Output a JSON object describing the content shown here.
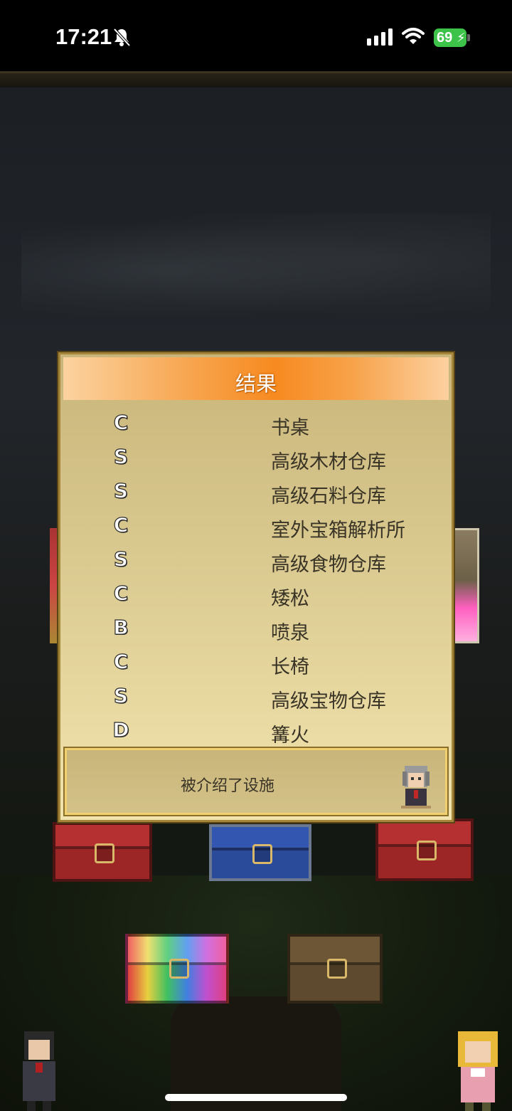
{
  "status_bar": {
    "time": "17:21",
    "battery": "69",
    "icons": [
      "bell-slash-icon",
      "cellular-signal-icon",
      "wifi-icon",
      "battery-charging-icon"
    ]
  },
  "dialog": {
    "title": "结果",
    "results": [
      {
        "grade": "C",
        "facility": "书桌"
      },
      {
        "grade": "S",
        "facility": "高级木材仓库"
      },
      {
        "grade": "S",
        "facility": "高级石料仓库"
      },
      {
        "grade": "C",
        "facility": "室外宝箱解析所"
      },
      {
        "grade": "S",
        "facility": "高级食物仓库"
      },
      {
        "grade": "C",
        "facility": "矮松"
      },
      {
        "grade": "B",
        "facility": "喷泉"
      },
      {
        "grade": "C",
        "facility": "长椅"
      },
      {
        "grade": "S",
        "facility": "高级宝物仓库"
      },
      {
        "grade": "D",
        "facility": "篝火"
      }
    ],
    "message": "被介绍了设施"
  },
  "colors": {
    "header_orange": "#f78a20",
    "panel_gold": "#d8c88e",
    "text_dark": "#3a3427"
  }
}
